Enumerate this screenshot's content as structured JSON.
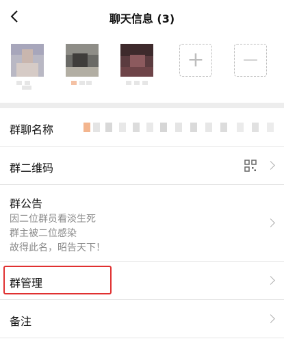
{
  "header": {
    "title": "聊天信息 (3)",
    "back_icon": "chevron-left-icon"
  },
  "members": {
    "add_icon": "plus-icon",
    "remove_icon": "minus-icon",
    "add_symbol": "+",
    "remove_symbol": "—"
  },
  "rows": {
    "group_name": {
      "label": "群聊名称"
    },
    "qr_code": {
      "label": "群二维码",
      "icon": "qr-code-icon"
    },
    "notice": {
      "label": "群公告",
      "lines": [
        "因二位群员看淡生死",
        "群主被二位感染",
        "故得此名，昭告天下！"
      ]
    },
    "manage": {
      "label": "群管理"
    },
    "remark": {
      "label": "备注"
    }
  },
  "colors": {
    "highlight": "#e03030",
    "separator": "#ededed"
  }
}
